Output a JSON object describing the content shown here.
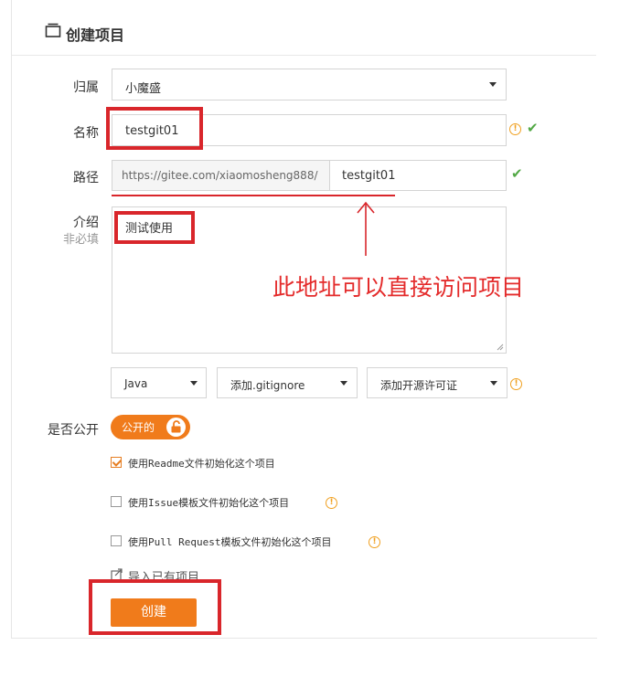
{
  "header": {
    "title": "创建项目"
  },
  "form": {
    "owner": {
      "label": "归属",
      "value": "小魔盛"
    },
    "name": {
      "label": "名称",
      "value": "testgit01"
    },
    "path": {
      "label": "路径",
      "prefix": "https://gitee.com/xiaomosheng888/",
      "value": "testgit01"
    },
    "intro": {
      "label": "介绍",
      "sublabel": "非必填",
      "value": "测试使用"
    },
    "selects": [
      {
        "value": "Java"
      },
      {
        "value": "添加.gitignore"
      },
      {
        "value": "添加开源许可证"
      }
    ],
    "visibility": {
      "label": "是否公开",
      "toggle_label": "公开的"
    },
    "options": [
      {
        "label": "使用Readme文件初始化这个项目",
        "checked": true
      },
      {
        "label": "使用Issue模板文件初始化这个项目",
        "checked": false
      },
      {
        "label": "使用Pull Request模板文件初始化这个项目",
        "checked": false
      }
    ],
    "import_link": "导入已有项目",
    "submit_label": "创建"
  },
  "annotation": {
    "text": "此地址可以直接访问项目"
  },
  "colors": {
    "accent": "#f07b1b",
    "annotation_red": "#d9262b",
    "check_green": "#52a845"
  }
}
